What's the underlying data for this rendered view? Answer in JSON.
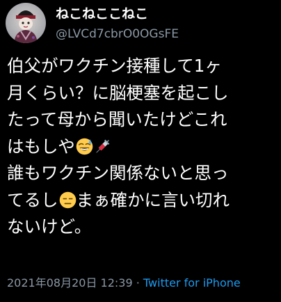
{
  "user": {
    "display_name": "ねこねここねこ",
    "handle": "@LVCd7cbrO0OGsFE"
  },
  "tweet": {
    "lines": [
      [
        "伯父がワクチン接種して1ヶ"
      ],
      [
        "月くらい？に脳梗塞を起こし"
      ],
      [
        "たって母から聞いたけどこれ"
      ],
      [
        "はもしや"
      ],
      [
        "誰もワクチン関係ないと思っ"
      ],
      [
        "てるし",
        "まぁ確かに言い切れ"
      ],
      [
        "ないけど。"
      ]
    ],
    "emoji_icons": [
      "grinning-sweat-emoji",
      "syringe-emoji",
      "expressionless-emoji"
    ]
  },
  "meta": {
    "timestamp": "2021年08月20日 12:39",
    "separator": " · ",
    "source": "Twitter for iPhone"
  },
  "colors": {
    "background": "#000000",
    "text": "#ffffff",
    "secondary": "#8b98a5",
    "link": "#1d9bf0"
  }
}
